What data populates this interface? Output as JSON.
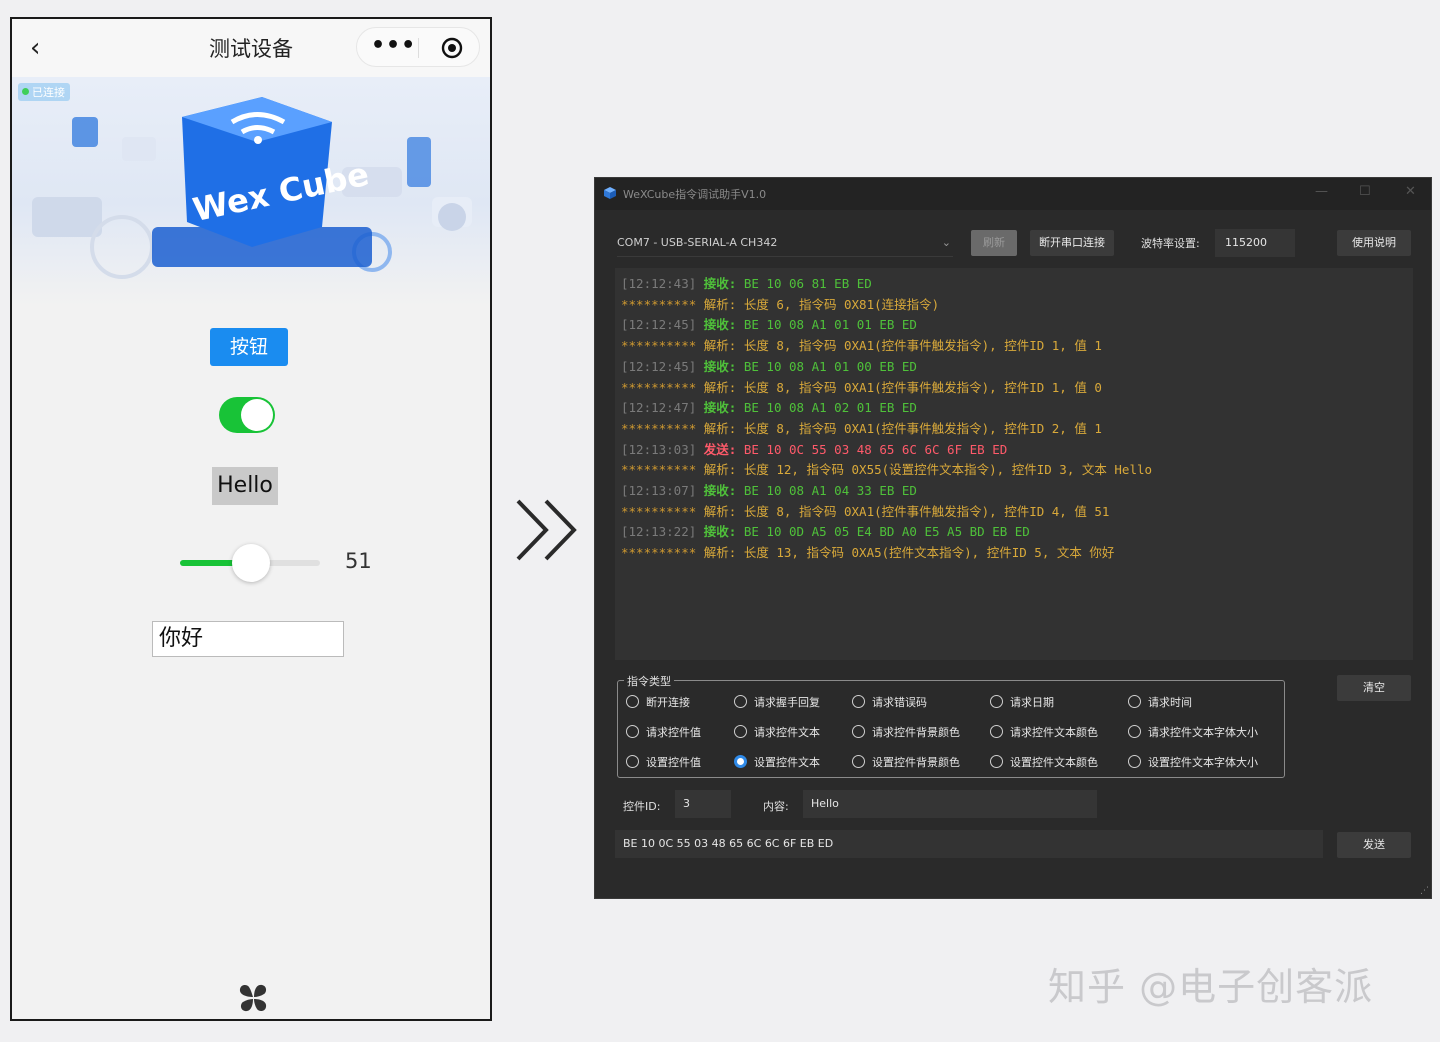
{
  "phone": {
    "back_glyph": "‹",
    "title": "测试设备",
    "more_glyph": "•••",
    "banner_brand": "Wex Cube",
    "connection_badge": "已连接",
    "button_label": "按钮",
    "switch_on": true,
    "hello_text": "Hello",
    "slider_value": "51",
    "slider_fraction": 0.51,
    "input_value": "你好"
  },
  "window": {
    "title": "WeXCube指令调试助手V1.0",
    "minimize": "—",
    "maximize": "☐",
    "close": "✕",
    "port": "COM7 - USB-SERIAL-A CH342",
    "refresh_label": "刷新",
    "disconnect_label": "断开串口连接",
    "baud_label": "波特率设置:",
    "baud_value": "115200",
    "help_label": "使用说明",
    "clear_label": "清空",
    "send_label": "发送",
    "cmd_group_label": "指令类型",
    "control_id_label": "控件ID:",
    "control_id_value": "3",
    "content_label": "内容:",
    "content_value": "Hello",
    "hex_output": "BE 10 0C 55 03 48 65 6C 6C 6F EB ED",
    "colors": {
      "rx": "#4fc13a",
      "tx": "#ff5a6a",
      "parse": "#d9a93a",
      "accent": "#2f8ae8"
    }
  },
  "log": [
    {
      "kind": "rx",
      "prefix": "[12:12:43]",
      "tag": "接收:",
      "body": "BE 10 06 81 EB ED"
    },
    {
      "kind": "parse",
      "prefix": "**********",
      "tag": "解析:",
      "body": "长度 6, 指令码 0X81(连接指令)"
    },
    {
      "kind": "rx",
      "prefix": "[12:12:45]",
      "tag": "接收:",
      "body": "BE 10 08 A1 01 01 EB ED"
    },
    {
      "kind": "parse",
      "prefix": "**********",
      "tag": "解析:",
      "body": "长度 8, 指令码 0XA1(控件事件触发指令), 控件ID 1, 值 1"
    },
    {
      "kind": "rx",
      "prefix": "[12:12:45]",
      "tag": "接收:",
      "body": "BE 10 08 A1 01 00 EB ED"
    },
    {
      "kind": "parse",
      "prefix": "**********",
      "tag": "解析:",
      "body": "长度 8, 指令码 0XA1(控件事件触发指令), 控件ID 1, 值 0"
    },
    {
      "kind": "rx",
      "prefix": "[12:12:47]",
      "tag": "接收:",
      "body": "BE 10 08 A1 02 01 EB ED"
    },
    {
      "kind": "parse",
      "prefix": "**********",
      "tag": "解析:",
      "body": "长度 8, 指令码 0XA1(控件事件触发指令), 控件ID 2, 值 1"
    },
    {
      "kind": "tx",
      "prefix": "[12:13:03]",
      "tag": "发送:",
      "body": "BE 10 0C 55 03 48 65 6C 6C 6F EB ED"
    },
    {
      "kind": "parse",
      "prefix": "**********",
      "tag": "解析:",
      "body": "长度 12, 指令码 0X55(设置控件文本指令), 控件ID 3, 文本 Hello"
    },
    {
      "kind": "rx",
      "prefix": "[12:13:07]",
      "tag": "接收:",
      "body": "BE 10 08 A1 04 33 EB ED"
    },
    {
      "kind": "parse",
      "prefix": "**********",
      "tag": "解析:",
      "body": "长度 8, 指令码 0XA1(控件事件触发指令), 控件ID 4, 值 51"
    },
    {
      "kind": "rx",
      "prefix": "[12:13:22]",
      "tag": "接收:",
      "body": "BE 10 0D A5 05 E4 BD A0 E5 A5 BD EB ED"
    },
    {
      "kind": "parse",
      "prefix": "**********",
      "tag": "解析:",
      "body": "长度 13, 指令码 0XA5(控件文本指令), 控件ID 5, 文本 你好"
    }
  ],
  "cmd_types": [
    [
      "断开连接",
      "请求握手回复",
      "请求错误码",
      "请求日期",
      "请求时间"
    ],
    [
      "请求控件值",
      "请求控件文本",
      "请求控件背景颜色",
      "请求控件文本颜色",
      "请求控件文本字体大小"
    ],
    [
      "设置控件值",
      "设置控件文本",
      "设置控件背景颜色",
      "设置控件文本颜色",
      "设置控件文本字体大小"
    ]
  ],
  "cmd_selected": "设置控件文本",
  "watermark": "知乎 @电子创客派"
}
